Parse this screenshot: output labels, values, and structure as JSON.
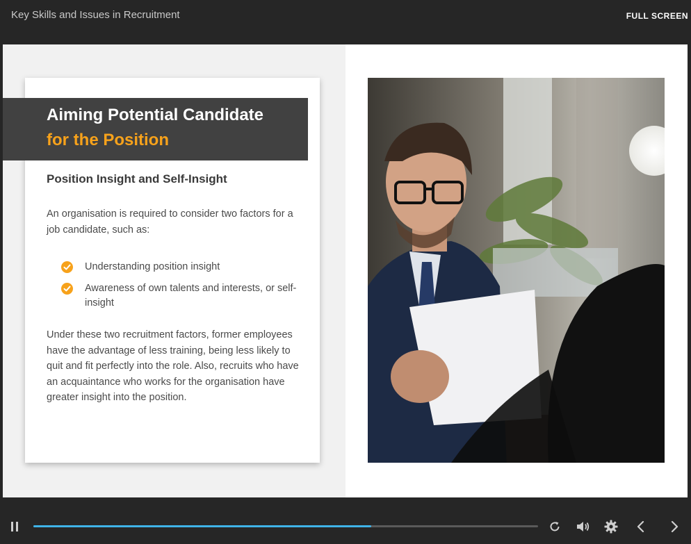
{
  "header": {
    "course_title": "Key Skills and Issues in Recruitment",
    "fullscreen_label": "FULL SCREEN"
  },
  "slide": {
    "title_line1": "Aiming Potential Candidate",
    "title_line2": "for the Position",
    "subheading": "Position Insight and Self-Insight",
    "intro": "An organisation is required to consider two factors for a job candidate, such as:",
    "bullets": [
      "Understanding position insight",
      "Awareness of own talents and interests, or self-insight"
    ],
    "outro": "Under these two recruitment factors, former employees have the advantage of less training, being less likely to quit and fit perfectly into the role. Also, recruits who have an acquaintance who works for the organisation have greater insight into the position."
  },
  "player": {
    "progress_fraction": 0.67,
    "icons": [
      "pause-icon",
      "replay-icon",
      "volume-icon",
      "settings-gear-icon",
      "prev-arrow-icon",
      "next-arrow-icon"
    ]
  },
  "colors": {
    "accent": "#f7a21b",
    "progress": "#3fb3e8",
    "chrome": "#262626",
    "title_band": "#414141"
  }
}
